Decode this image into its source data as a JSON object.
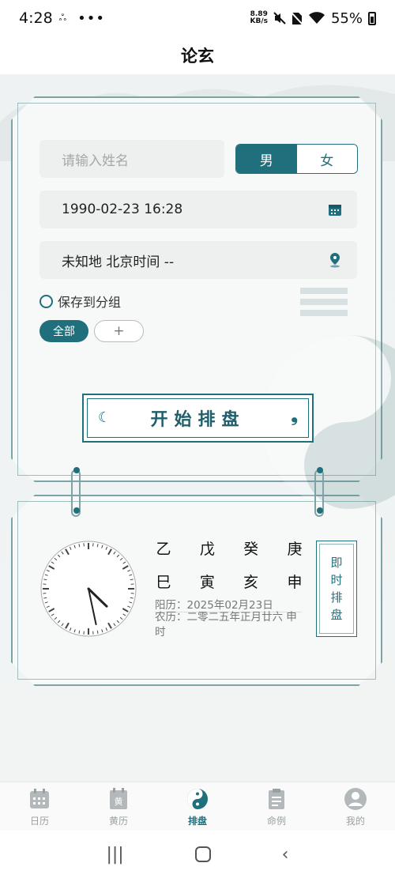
{
  "status_bar": {
    "time": "4:28",
    "net_speed_value": "8.89",
    "net_speed_unit": "KB/s",
    "battery": "55%"
  },
  "header": {
    "title": "论玄"
  },
  "form": {
    "name_placeholder": "请输入姓名",
    "gender_male": "男",
    "gender_female": "女",
    "gender_selected": "男",
    "datetime": "1990-02-23 16:28",
    "location": "未知地 北京时间 --",
    "save_to_group": "保存到分组",
    "group_all": "全部",
    "group_add": "+",
    "start_button": "开始排盘"
  },
  "now_panel": {
    "stems": [
      "乙",
      "戊",
      "癸",
      "庚"
    ],
    "branches": [
      "巳",
      "寅",
      "亥",
      "申"
    ],
    "solar": "阳历：2025年02月23日",
    "lunar": "农历：二零二五年正月廿六 申时",
    "instant_button": [
      "即",
      "时",
      "排",
      "盘"
    ],
    "clock_hour": 4,
    "clock_minute": 28
  },
  "tabs": [
    {
      "label": "日历",
      "icon": "calendar-icon",
      "active": false
    },
    {
      "label": "黄历",
      "icon": "almanac-icon",
      "active": false
    },
    {
      "label": "排盘",
      "icon": "yinyang-icon",
      "active": true
    },
    {
      "label": "命例",
      "icon": "clipboard-icon",
      "active": false
    },
    {
      "label": "我的",
      "icon": "user-icon",
      "active": false
    }
  ],
  "colors": {
    "accent": "#1f6f7c",
    "frame": "#7ea3a6"
  }
}
